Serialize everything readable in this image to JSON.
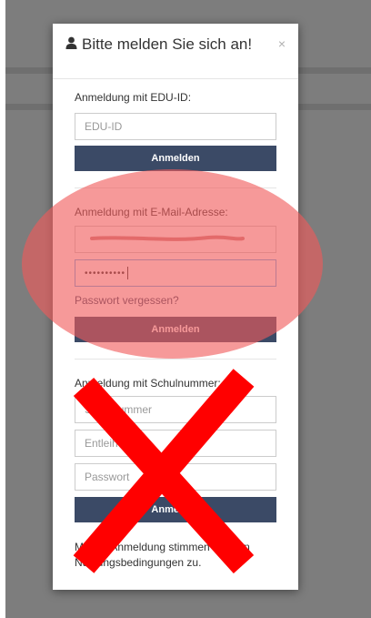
{
  "modal": {
    "title": "Bitte melden Sie sich an!",
    "close_label": "×"
  },
  "edu_id_section": {
    "label": "Anmeldung mit EDU-ID:",
    "input_placeholder": "EDU-ID",
    "button_label": "Anmelden"
  },
  "email_section": {
    "label": "Anmeldung mit E-Mail-Adresse:",
    "email_value": "",
    "password_value": "••••••••••",
    "forgot_password_link": "Passwort vergessen?",
    "button_label": "Anmelden"
  },
  "school_section": {
    "label": "Anmeldung mit Schulnummer:",
    "school_number_placeholder": "Schulnummer",
    "lending_placeholder": "Entleiher",
    "password_placeholder": "Passwort",
    "button_label": "Anmelden"
  },
  "terms_note": "Mit der Anmeldung stimmen Sie den Nutzungsbedingungen zu.",
  "overlay": {
    "highlight_color": "#f05a5a",
    "cross_color": "#ff0000"
  }
}
